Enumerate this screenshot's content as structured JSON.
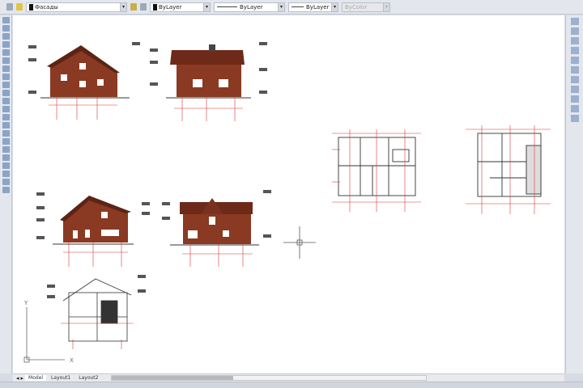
{
  "toolbar": {
    "layer_value": "Фасады",
    "color_value": "ByLayer",
    "linetype_value": "ByLayer",
    "lineweight_value": "ByLayer",
    "plotstyle_value": "ByColor"
  },
  "tabs": [
    "Model",
    "Layout1",
    "Layout2"
  ],
  "ucs": {
    "x_label": "X",
    "y_label": "Y"
  },
  "colors": {
    "brick": "#8a3a22",
    "roof": "#6e2a18",
    "dimension": "#d33",
    "canvas": "#ffffff"
  }
}
